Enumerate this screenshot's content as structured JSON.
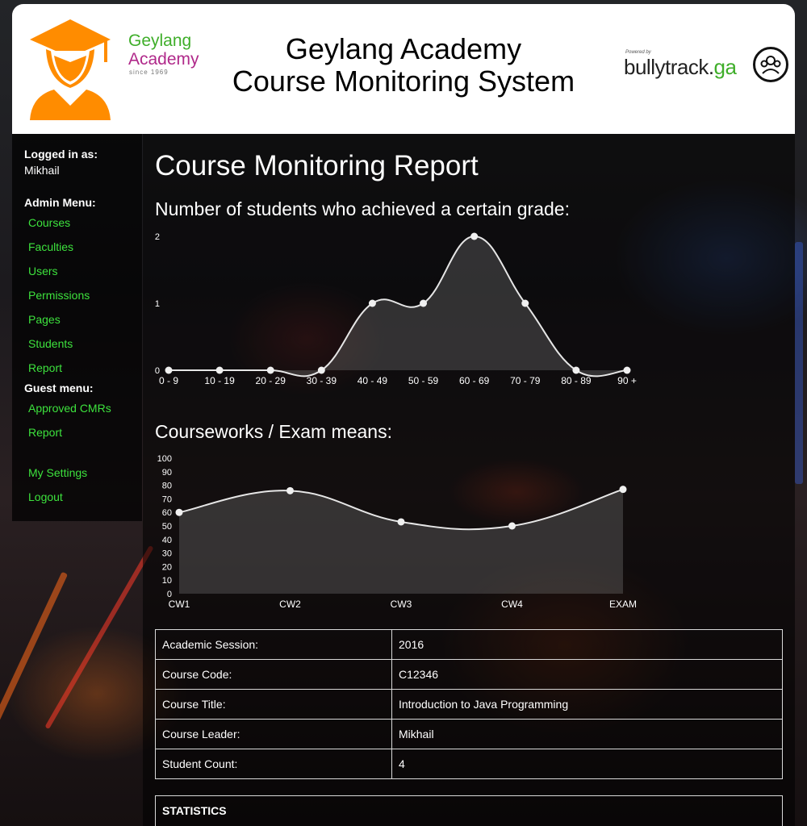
{
  "header": {
    "logo_line1": "Geylang",
    "logo_line2": "Academy",
    "logo_line3": "since 1969",
    "title_line1": "Geylang Academy",
    "title_line2": "Course Monitoring System",
    "powered_by": "Powered by",
    "brand_main": "bullytrack.",
    "brand_suffix": "ga"
  },
  "sidebar": {
    "logged_in_label": "Logged in as:",
    "username": "Mikhail",
    "admin_menu_label": "Admin Menu:",
    "admin_items": [
      "Courses",
      "Faculties",
      "Users",
      "Permissions",
      "Pages",
      "Students",
      "Report"
    ],
    "guest_menu_label": "Guest menu:",
    "guest_items": [
      "Approved CMRs",
      "Report"
    ],
    "settings_label": "My Settings",
    "logout_label": "Logout"
  },
  "main": {
    "page_title": "Course Monitoring Report",
    "grade_chart_title": "Number of students who achieved a certain grade:",
    "means_chart_title": "Courseworks / Exam means:"
  },
  "chart_data": [
    {
      "type": "area",
      "title": "Number of students who achieved a certain grade:",
      "categories": [
        "0 - 9",
        "10 - 19",
        "20 - 29",
        "30 - 39",
        "40 - 49",
        "50 - 59",
        "60 - 69",
        "70 - 79",
        "80 - 89",
        "90 +"
      ],
      "values": [
        0,
        0,
        0,
        0,
        1,
        1,
        2,
        1,
        0,
        0
      ],
      "ylim": [
        0,
        2
      ],
      "yticks": [
        "0",
        "1",
        "2"
      ],
      "grid": false
    },
    {
      "type": "area",
      "title": "Courseworks / Exam means:",
      "categories": [
        "CW1",
        "CW2",
        "CW3",
        "CW4",
        "EXAM"
      ],
      "values": [
        60,
        76,
        53,
        50,
        77
      ],
      "ylim": [
        0,
        100
      ],
      "yticks": [
        "0",
        "10",
        "20",
        "30",
        "40",
        "50",
        "60",
        "70",
        "80",
        "90",
        "100"
      ],
      "grid": false
    }
  ],
  "course_info": {
    "rows": [
      {
        "label": "Academic Session:",
        "value": "2016"
      },
      {
        "label": "Course Code:",
        "value": "C12346"
      },
      {
        "label": "Course Title:",
        "value": "Introduction to Java Programming"
      },
      {
        "label": "Course Leader:",
        "value": "Mikhail"
      },
      {
        "label": "Student Count:",
        "value": "4"
      }
    ]
  },
  "statistics": {
    "heading": "STATISTICS"
  },
  "colors": {
    "link": "#3de23d",
    "logo_orange": "#ff8c00",
    "logo_green": "#3fae2a",
    "logo_purple": "#b0298a"
  }
}
